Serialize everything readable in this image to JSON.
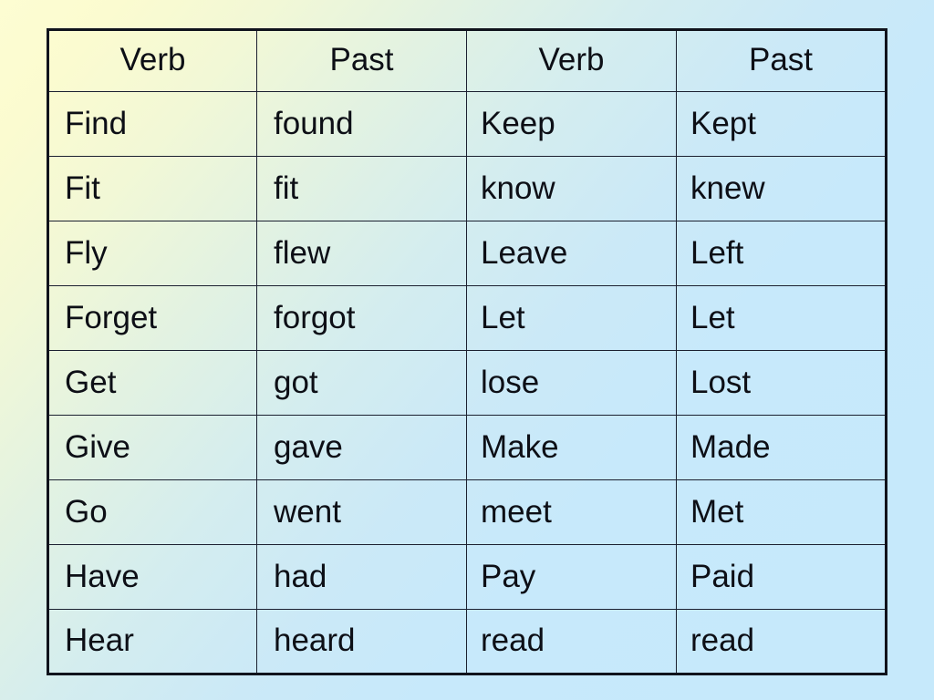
{
  "slide": {
    "background_start_color": "#fbfbd0",
    "background_end_color": "#c6e9fb",
    "table_border_color": "#10131c",
    "text_color": "#0d0f16"
  },
  "table": {
    "headers": [
      "Verb",
      "Past",
      "Verb",
      "Past"
    ],
    "rows": [
      [
        "Find",
        "found",
        "Keep",
        "Kept"
      ],
      [
        "Fit",
        "fit",
        "know",
        "knew"
      ],
      [
        "Fly",
        "flew",
        "Leave",
        "Left"
      ],
      [
        "Forget",
        "forgot",
        "Let",
        "Let"
      ],
      [
        "Get",
        "got",
        "lose",
        "Lost"
      ],
      [
        "Give",
        "gave",
        "Make",
        "Made"
      ],
      [
        "Go",
        "went",
        "meet",
        "Met"
      ],
      [
        "Have",
        "had",
        "Pay",
        "Paid"
      ],
      [
        "Hear",
        "heard",
        "read",
        "read"
      ]
    ]
  }
}
